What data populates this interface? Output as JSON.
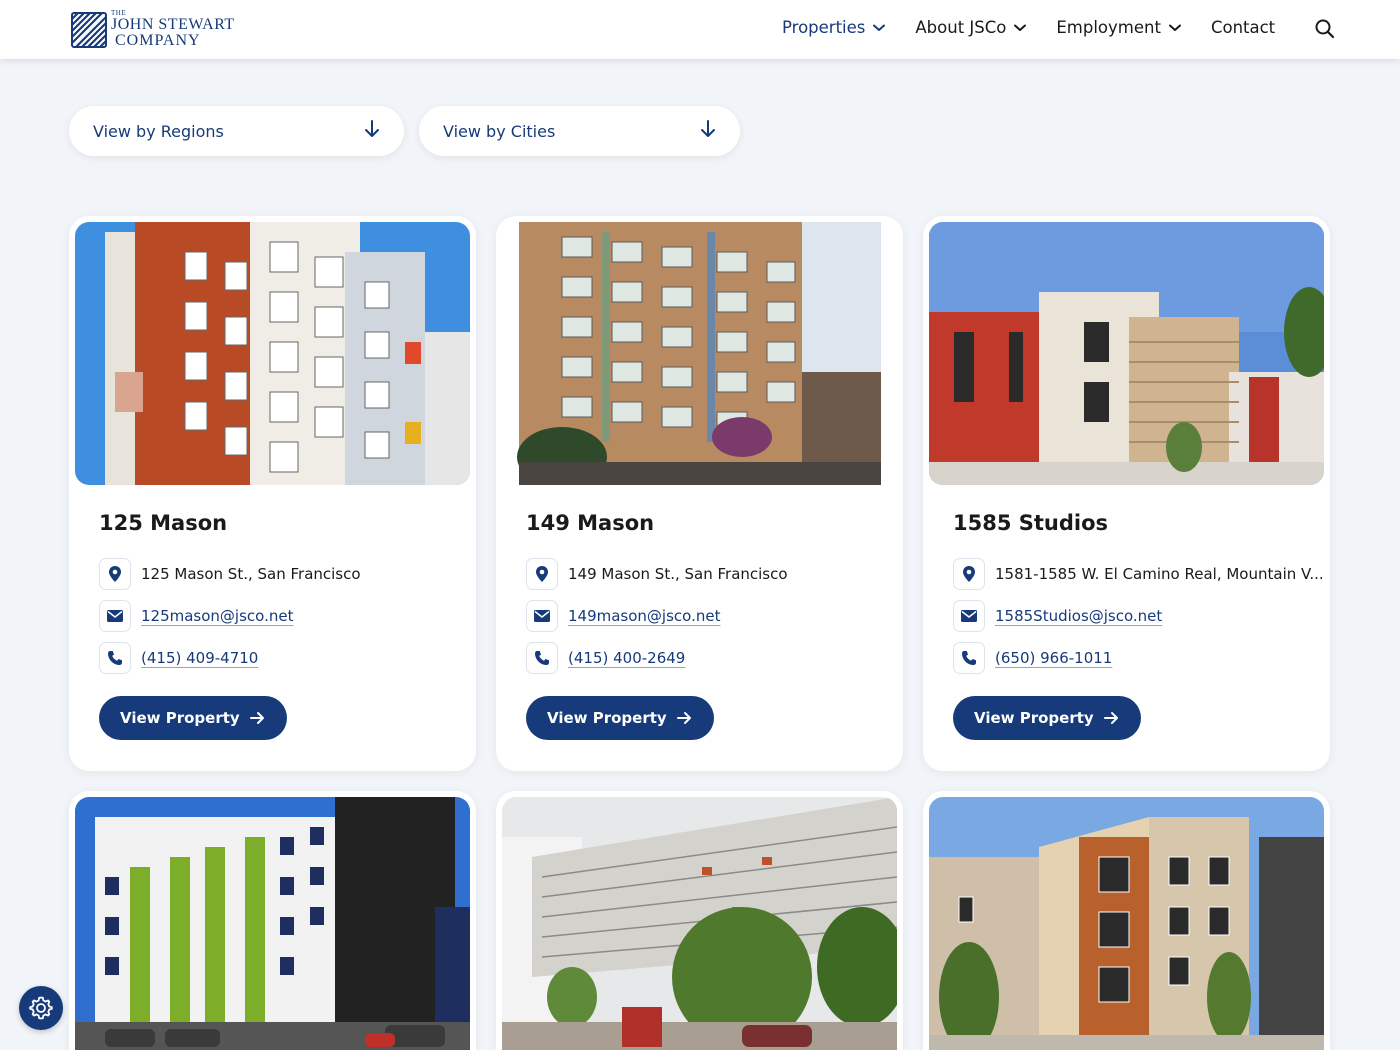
{
  "brand": {
    "logo_small": "THE",
    "logo_line1": "JOHN STEWART",
    "logo_line2": "COMPANY",
    "primary_color": "#163a7a"
  },
  "nav": {
    "items": [
      {
        "label": "Properties",
        "has_dropdown": true,
        "active": true
      },
      {
        "label": "About JSCo",
        "has_dropdown": true,
        "active": false
      },
      {
        "label": "Employment",
        "has_dropdown": true,
        "active": false
      },
      {
        "label": "Contact",
        "has_dropdown": false,
        "active": false
      }
    ],
    "search_icon": "search-icon"
  },
  "filters": {
    "regions_label": "View by Regions",
    "cities_label": "View by Cities"
  },
  "properties": [
    {
      "name": "125 Mason",
      "address": "125 Mason St., San Francisco",
      "email": "125mason@jsco.net",
      "phone": "(415) 409-4710",
      "button": "View Property"
    },
    {
      "name": "149 Mason",
      "address": "149 Mason St., San Francisco",
      "email": "149mason@jsco.net",
      "phone": "(415) 400-2649",
      "button": "View Property"
    },
    {
      "name": "1585 Studios",
      "address": "1581-1585 W. El Camino Real, Mountain V...",
      "email": "1585Studios@jsco.net",
      "phone": "(650) 966-1011",
      "button": "View Property"
    }
  ],
  "settings_icon": "gear-icon"
}
